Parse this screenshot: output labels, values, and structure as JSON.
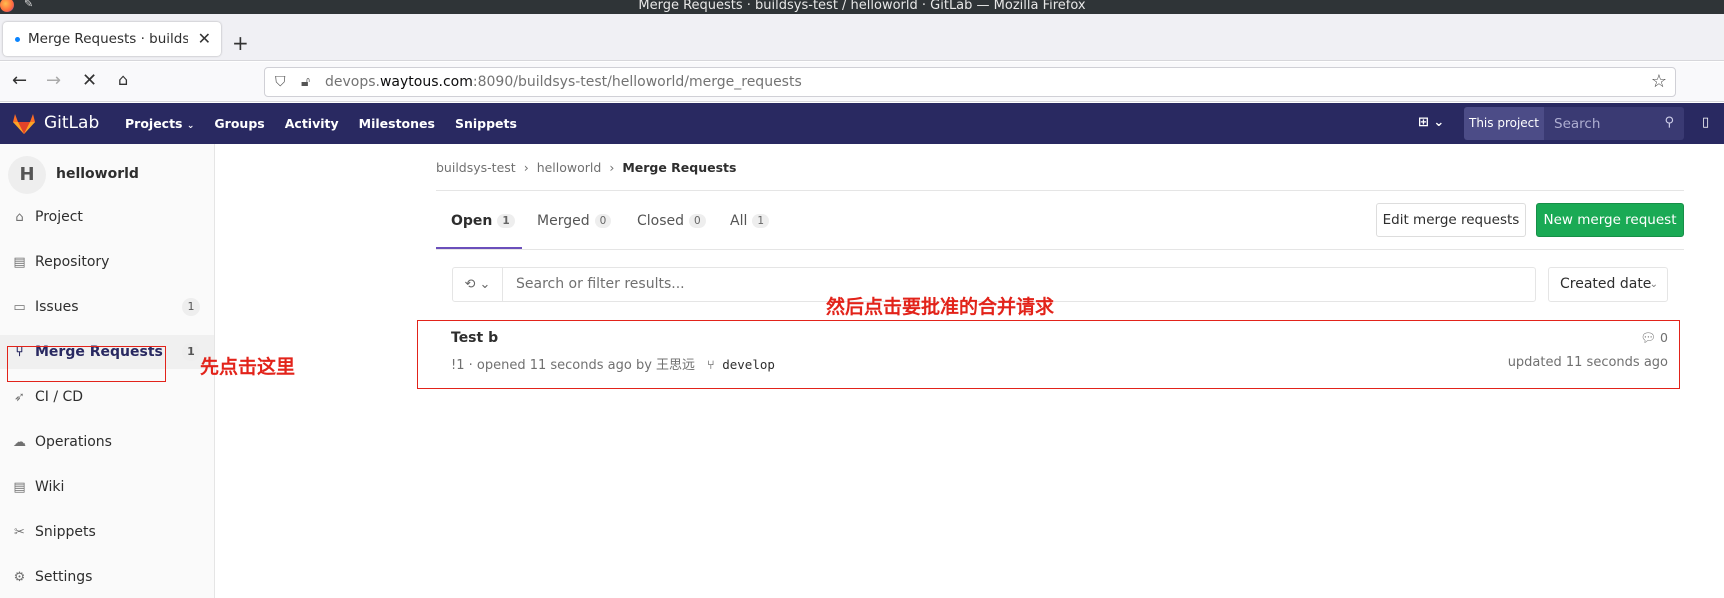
{
  "window": {
    "title": "Merge Requests · buildsys-test / helloworld · GitLab — Mozilla Firefox"
  },
  "browser": {
    "tab_title": "Merge Requests · buildsys-test / helloworld",
    "url_prefix": "devops.",
    "url_domain": "waytous.com",
    "url_suffix": ":8090/buildsys-test/helloworld/merge_requests"
  },
  "gitlab": {
    "brand": "GitLab",
    "nav": [
      "Projects",
      "Groups",
      "Activity",
      "Milestones",
      "Snippets"
    ],
    "search_scope": "This project",
    "search_placeholder": "Search"
  },
  "sidebar": {
    "avatar_letter": "H",
    "project_name": "helloworld",
    "items": [
      {
        "label": "Project",
        "icon": "home-icon"
      },
      {
        "label": "Repository",
        "icon": "book-icon"
      },
      {
        "label": "Issues",
        "icon": "issues-icon",
        "count": "1"
      },
      {
        "label": "Merge Requests",
        "icon": "merge-request-icon",
        "count": "1",
        "active": true
      },
      {
        "label": "CI / CD",
        "icon": "rocket-icon"
      },
      {
        "label": "Operations",
        "icon": "cloud-gear-icon"
      },
      {
        "label": "Wiki",
        "icon": "book-icon"
      },
      {
        "label": "Snippets",
        "icon": "scissors-icon"
      },
      {
        "label": "Settings",
        "icon": "settings-icon"
      }
    ]
  },
  "breadcrumb": [
    "buildsys-test",
    "helloworld",
    "Merge Requests"
  ],
  "tabs": [
    {
      "label": "Open",
      "count": "1"
    },
    {
      "label": "Merged",
      "count": "0"
    },
    {
      "label": "Closed",
      "count": "0"
    },
    {
      "label": "All",
      "count": "1"
    }
  ],
  "buttons": {
    "edit": "Edit merge requests",
    "new": "New merge request"
  },
  "filter": {
    "placeholder": "Search or filter results...",
    "sort": "Created date"
  },
  "merge_request": {
    "title": "Test b",
    "meta": "!1 · opened 11 seconds ago by 王思远",
    "branch": "develop",
    "comments": "0",
    "updated": "updated 11 seconds ago"
  },
  "annotations": {
    "click_here_first": "先点击这里",
    "then_click_mr": "然后点击要批准的合并请求"
  },
  "colors": {
    "gitlab_header": "#292961",
    "accent_green": "#1aaa55",
    "annotation_red": "#e2231a"
  }
}
